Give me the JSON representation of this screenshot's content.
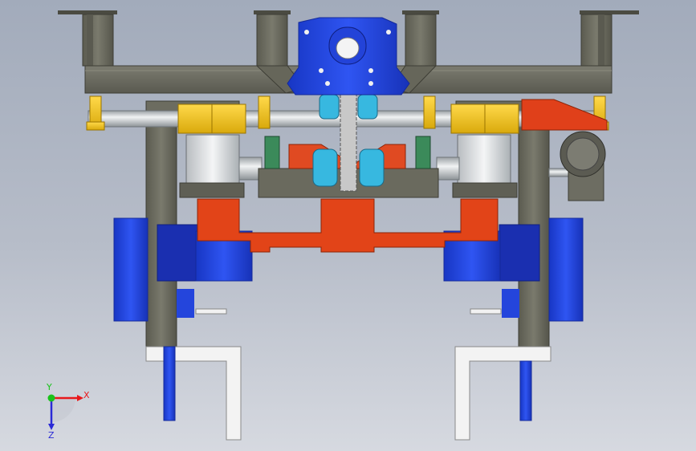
{
  "viewport": {
    "background_top": "#a2abbb",
    "background_bottom": "#d6d9e0"
  },
  "triad": {
    "x_label": "X",
    "y_label": "Y",
    "z_label": "Z",
    "x_color": "#e8181b",
    "y_color": "#19c21a",
    "z_color": "#2a2ad6"
  },
  "colors": {
    "frame_gray": "#6e6e62",
    "bracket_yellow": "#f2c21a",
    "motor_blue": "#1f3fe0",
    "plate_red": "#e0401a",
    "shaft_silver": "#cfd3d6",
    "bearing_cyan": "#37b8e0",
    "slot_white": "#f2f2f2"
  }
}
